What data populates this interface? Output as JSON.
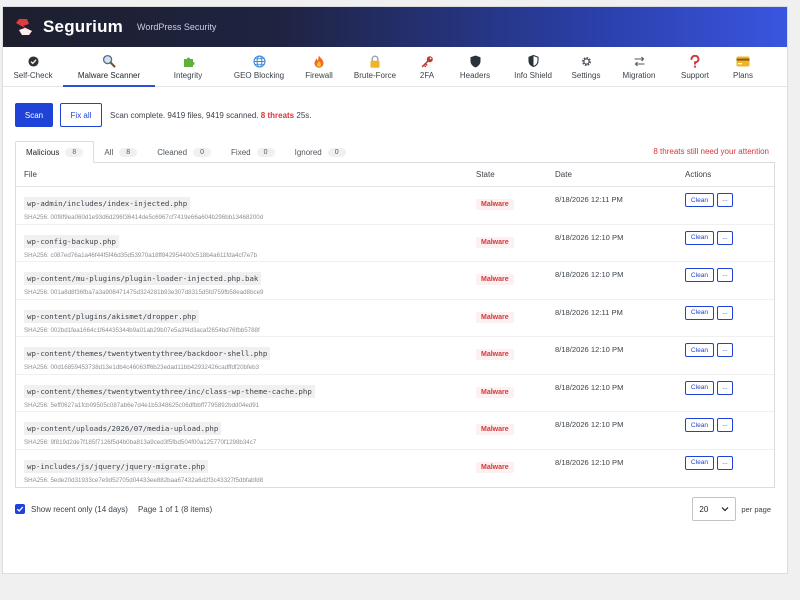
{
  "header": {
    "brand": "Segurium",
    "tagline": "WordPress Security",
    "colors": {
      "start": "#1d1f2e",
      "end": "#3a55e0"
    }
  },
  "tabs": [
    {
      "label": "Self-Check",
      "icon": "check-circle-icon"
    },
    {
      "label": "Malware Scanner",
      "icon": "magnifier-icon",
      "active": true
    },
    {
      "label": "Integrity",
      "icon": "puzzle-icon"
    },
    {
      "label": "GEO Blocking",
      "icon": "globe-icon"
    },
    {
      "label": "Firewall",
      "icon": "flame-icon"
    },
    {
      "label": "Brute-Force",
      "icon": "lock-icon"
    },
    {
      "label": "2FA",
      "icon": "key-icon"
    },
    {
      "label": "Headers",
      "icon": "shield-icon"
    },
    {
      "label": "Info Shield",
      "icon": "info-shield-icon"
    },
    {
      "label": "Settings",
      "icon": "gear-icon"
    },
    {
      "label": "Migration",
      "icon": "arrows-icon"
    },
    {
      "label": "Support",
      "icon": "question-icon"
    },
    {
      "label": "Plans",
      "icon": "card-icon"
    }
  ],
  "toolbar": {
    "scan_label": "Scan",
    "fixall_label": "Fix all",
    "status_prefix": "Scan complete. 9419 files, 9419 scanned.",
    "status_threats": "8 threats",
    "status_suffix": "25s."
  },
  "filters": [
    {
      "label": "Malicious",
      "count": "8"
    },
    {
      "label": "All",
      "count": "8"
    },
    {
      "label": "Cleaned",
      "count": "0"
    },
    {
      "label": "Fixed",
      "count": "0"
    },
    {
      "label": "Ignored",
      "count": "0"
    }
  ],
  "attention": "8 threats still need your attention",
  "table": {
    "columns": {
      "file": "File",
      "state": "State",
      "date": "Date",
      "actions": "Actions"
    },
    "clean_label": "Clean",
    "more_label": "...",
    "rows": [
      {
        "path": "wp-admin/includes/index-injected.php",
        "sha": "SHA256: 00f8f9ea060d1e93d6d296f36414de5c6967cf7419e66a604b296bb13468200d",
        "state": "Malware",
        "date": "8/18/2026 12:11 PM"
      },
      {
        "path": "wp-config-backup.php",
        "sha": "SHA256: c087ed76a1a46f44f5f46d35d53970a18ff842954400c518b4a611fda4cf7e7b",
        "state": "Malware",
        "date": "8/18/2026 12:10 PM"
      },
      {
        "path": "wp-content/mu-plugins/plugin-loader-injected.php.bak",
        "sha": "SHA256: 001a8d8f36fba7a3a908471475d324281b93e307d8315d5fd759fb58ead8bce9",
        "state": "Malware",
        "date": "8/18/2026 12:10 PM"
      },
      {
        "path": "wp-content/plugins/akismet/dropper.php",
        "sha": "SHA256: 002bd1fea1664c1f64435344b9a01ab29b07e5a3f4d3acaf2654bd76fbb5788f",
        "state": "Malware",
        "date": "8/18/2026 12:11 PM"
      },
      {
        "path": "wp-content/themes/twentytwentythree/backdoor-shell.php",
        "sha": "SHA256: 00d16859453738d13e1db4c46063ff6b23edad11bb42932426cadffdf20bfeb3",
        "state": "Malware",
        "date": "8/18/2026 12:10 PM"
      },
      {
        "path": "wp-content/themes/twentytwentythree/inc/class-wp-theme-cache.php",
        "sha": "SHA256: 5eff0627a1fcb09505c087ab6e7d4e1b5348625c06dfbbff7795892bdd04ed91",
        "state": "Malware",
        "date": "8/18/2026 12:10 PM"
      },
      {
        "path": "wp-content/uploads/2026/07/media-upload.php",
        "sha": "SHA256: 9f819d2de7f185f7126f5d4b0ba813a9ced3f5fbd504f00a125770f1298b34c7",
        "state": "Malware",
        "date": "8/18/2026 12:10 PM"
      },
      {
        "path": "wp-includes/js/jquery/jquery-migrate.php",
        "sha": "SHA256: 5ede20d31933ce7e9d52705d04433ee882baa67432a6d2f3c43327f5dbfabfd8",
        "state": "Malware",
        "date": "8/18/2026 12:10 PM"
      }
    ]
  },
  "footer": {
    "recent_label": "Show recent only (14 days)",
    "page_info": "Page 1 of 1 (8 items)",
    "per_page_value": "20",
    "per_page_label": "per page"
  }
}
